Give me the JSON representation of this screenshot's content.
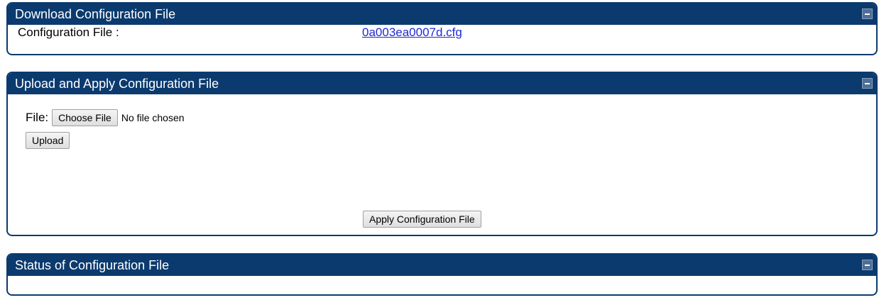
{
  "download": {
    "title": "Download Configuration File",
    "label": "Configuration File :",
    "file_link": "0a003ea0007d.cfg"
  },
  "upload": {
    "title": "Upload and Apply Configuration File",
    "file_label": "File:",
    "choose_button": "Choose File",
    "file_status": "No file chosen",
    "upload_button": "Upload",
    "apply_button": "Apply Configuration File"
  },
  "status": {
    "title": "Status of Configuration File",
    "message": ""
  },
  "colors": {
    "header_background": "#0b3a6e",
    "header_text": "#ffffff",
    "link": "#1f28d6"
  },
  "icons": {
    "collapse": "collapse-icon"
  }
}
